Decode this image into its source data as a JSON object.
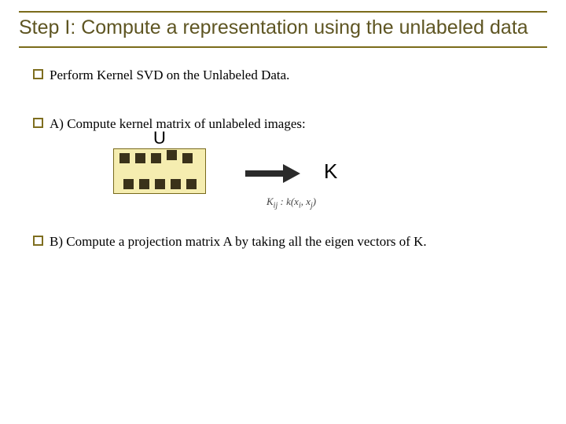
{
  "title": "Step I: Compute a representation using the unlabeled data",
  "bullets": {
    "b1": "Perform Kernel SVD on the Unlabeled Data.",
    "b2": "A) Compute kernel matrix of unlabeled images:",
    "b3": "B) Compute a projection matrix A by taking all the eigen vectors of K."
  },
  "figure": {
    "u_label": "U",
    "k_label": "K",
    "formula_lhs": "K",
    "formula_sub_ij": "ij",
    "formula_mid": " : k(x",
    "formula_sub_i": "i",
    "formula_comma": ", x",
    "formula_sub_j": "j",
    "formula_close": ")"
  }
}
